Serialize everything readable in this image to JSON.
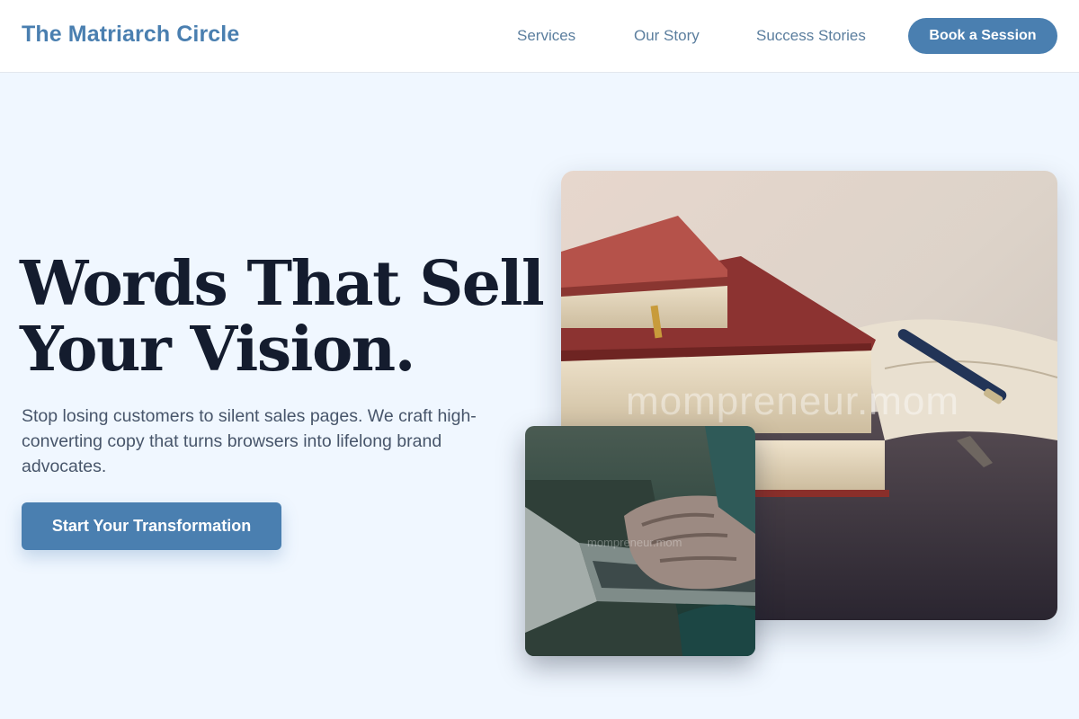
{
  "brand": {
    "name": "The Matriarch Circle"
  },
  "nav": {
    "links": [
      "Services",
      "Our Story",
      "Success Stories"
    ],
    "cta": "Book a Session"
  },
  "hero": {
    "title_line1": "Words That Sell",
    "title_line2": "Your Vision.",
    "subtitle": "Stop losing customers to silent sales pages. We craft high-converting copy that turns browsers into lifelong brand advocates.",
    "cta": "Start Your Transformation"
  },
  "images": {
    "main_watermark": "mompreneur.mom",
    "small_watermark": "mompreneur.mom"
  },
  "colors": {
    "accent": "#4a7fb0",
    "heading": "#141c2e",
    "background": "#f0f7ff"
  }
}
